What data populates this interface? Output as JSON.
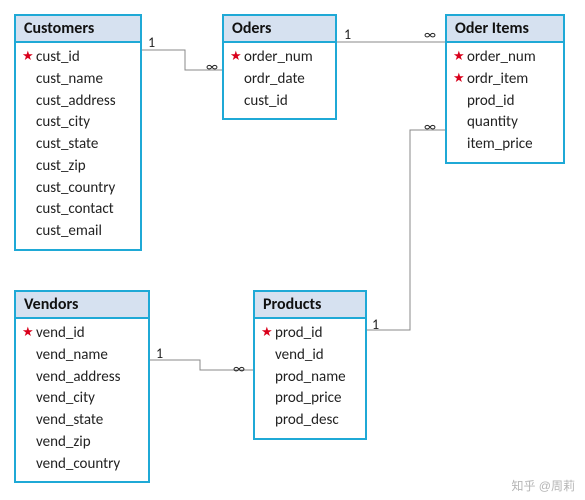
{
  "entities": {
    "customers": {
      "title": "Customers",
      "fields": [
        {
          "name": "cust_id",
          "pk": true
        },
        {
          "name": "cust_name",
          "pk": false
        },
        {
          "name": "cust_address",
          "pk": false
        },
        {
          "name": "cust_city",
          "pk": false
        },
        {
          "name": "cust_state",
          "pk": false
        },
        {
          "name": "cust_zip",
          "pk": false
        },
        {
          "name": "cust_country",
          "pk": false
        },
        {
          "name": "cust_contact",
          "pk": false
        },
        {
          "name": "cust_email",
          "pk": false
        }
      ]
    },
    "orders": {
      "title": "Oders",
      "fields": [
        {
          "name": "order_num",
          "pk": true
        },
        {
          "name": "ordr_date",
          "pk": false
        },
        {
          "name": "cust_id",
          "pk": false
        }
      ]
    },
    "order_items": {
      "title": "Oder Items",
      "fields": [
        {
          "name": "order_num",
          "pk": true
        },
        {
          "name": "ordr_item",
          "pk": true
        },
        {
          "name": "prod_id",
          "pk": false
        },
        {
          "name": "quantity",
          "pk": false
        },
        {
          "name": "item_price",
          "pk": false
        }
      ]
    },
    "vendors": {
      "title": "Vendors",
      "fields": [
        {
          "name": "vend_id",
          "pk": true
        },
        {
          "name": "vend_name",
          "pk": false
        },
        {
          "name": "vend_address",
          "pk": false
        },
        {
          "name": "vend_city",
          "pk": false
        },
        {
          "name": "vend_state",
          "pk": false
        },
        {
          "name": "vend_zip",
          "pk": false
        },
        {
          "name": "vend_country",
          "pk": false
        }
      ]
    },
    "products": {
      "title": "Products",
      "fields": [
        {
          "name": "prod_id",
          "pk": true
        },
        {
          "name": "vend_id",
          "pk": false
        },
        {
          "name": "prod_name",
          "pk": false
        },
        {
          "name": "prod_price",
          "pk": false
        },
        {
          "name": "prod_desc",
          "pk": false
        }
      ]
    }
  },
  "relationships": [
    {
      "from": "customers",
      "to": "orders",
      "from_card": "1",
      "to_card": "∞"
    },
    {
      "from": "orders",
      "to": "order_items",
      "from_card": "1",
      "to_card": "∞"
    },
    {
      "from": "products",
      "to": "order_items",
      "from_card": "1",
      "to_card": "∞"
    },
    {
      "from": "vendors",
      "to": "products",
      "from_card": "1",
      "to_card": "∞"
    }
  ],
  "cardinality_labels": {
    "one": "1",
    "many": "∞"
  },
  "watermark": "知乎 @周莉"
}
